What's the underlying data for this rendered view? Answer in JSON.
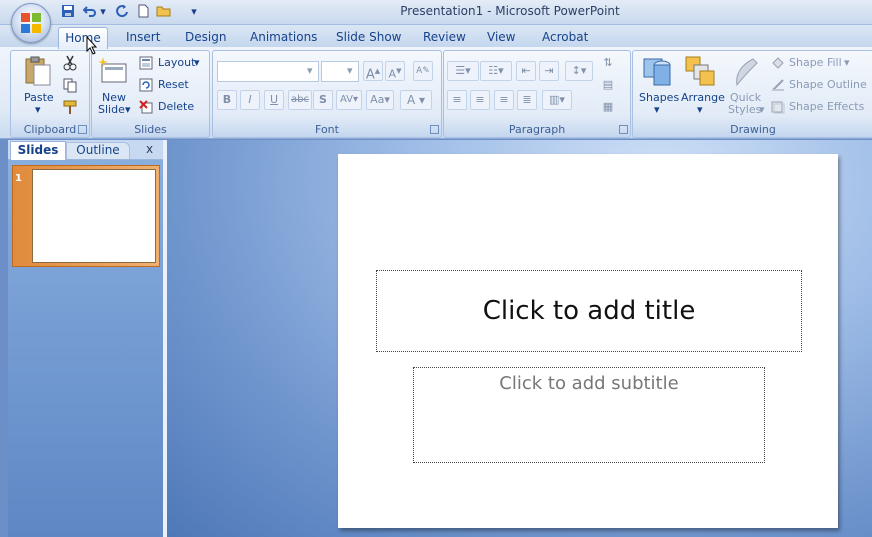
{
  "window": {
    "title": "Presentation1 - Microsoft PowerPoint"
  },
  "tabs": [
    "Home",
    "Insert",
    "Design",
    "Animations",
    "Slide Show",
    "Review",
    "View",
    "Acrobat"
  ],
  "ribbon": {
    "clipboard": {
      "label": "Clipboard",
      "paste": "Paste"
    },
    "slides": {
      "label": "Slides",
      "new_slide_line1": "New",
      "new_slide_line2": "Slide",
      "layout": "Layout",
      "reset": "Reset",
      "delete": "Delete"
    },
    "font": {
      "label": "Font"
    },
    "paragraph": {
      "label": "Paragraph"
    },
    "drawing": {
      "label": "Drawing",
      "shapes": "Shapes",
      "arrange": "Arrange",
      "quick_line1": "Quick",
      "quick_line2": "Styles",
      "shape_fill": "Shape Fill",
      "shape_outline": "Shape Outline",
      "shape_effects": "Shape Effects"
    }
  },
  "leftpane": {
    "slides_tab": "Slides",
    "outline_tab": "Outline",
    "close": "x",
    "slide_number": "1"
  },
  "slide": {
    "title_placeholder": "Click to add title",
    "subtitle_placeholder": "Click to add subtitle"
  },
  "colors": {
    "accent": "#15428b",
    "selected_thumb": "#e08a3c",
    "workspace": "#6f95cd"
  }
}
